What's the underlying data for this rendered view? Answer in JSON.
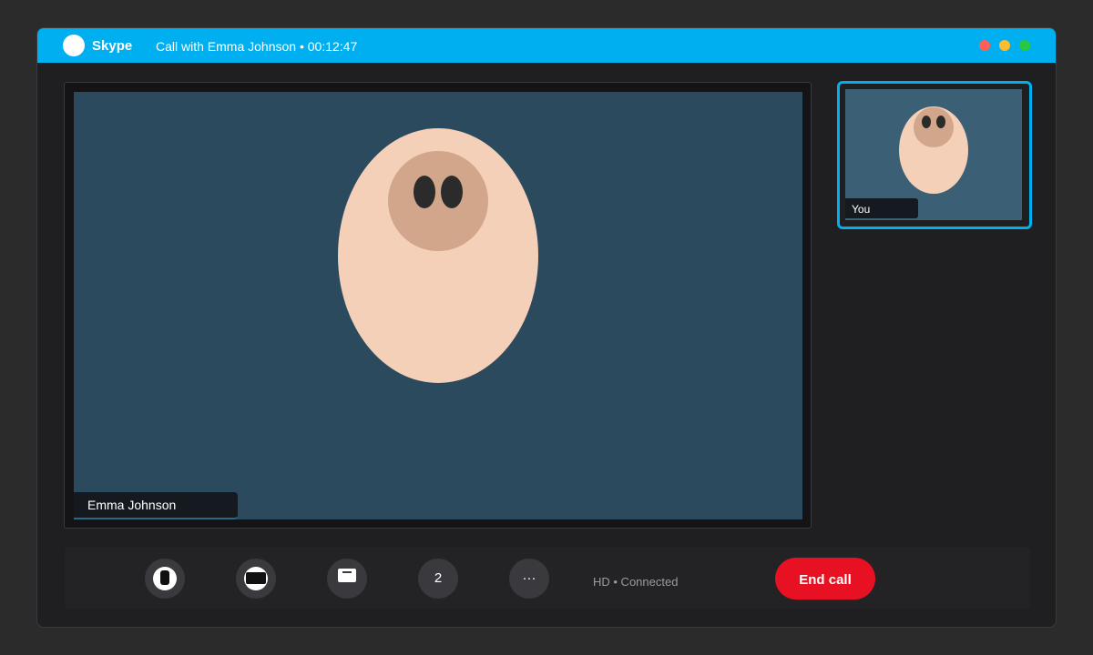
{
  "app": {
    "name": "Skype",
    "call_title": "Call with Emma Johnson • 00:12:47"
  },
  "window_controls": [
    {
      "name": "close",
      "color": "#ff5f57"
    },
    {
      "name": "minimize",
      "color": "#febc2e"
    },
    {
      "name": "maximize",
      "color": "#28c840"
    }
  ],
  "main_video": {
    "participant_name": "Emma Johnson",
    "background": "#2b4a5e"
  },
  "self_view": {
    "label": "You",
    "accent": "#00aff0"
  },
  "controls": {
    "mic_icon": "microphone-icon",
    "camera_icon": "camera-icon",
    "chat_icon": "chat-icon",
    "participants_count": "2",
    "more_label": "···",
    "status": "HD • Connected",
    "end_call_label": "End call",
    "end_call_color": "#e81123"
  }
}
